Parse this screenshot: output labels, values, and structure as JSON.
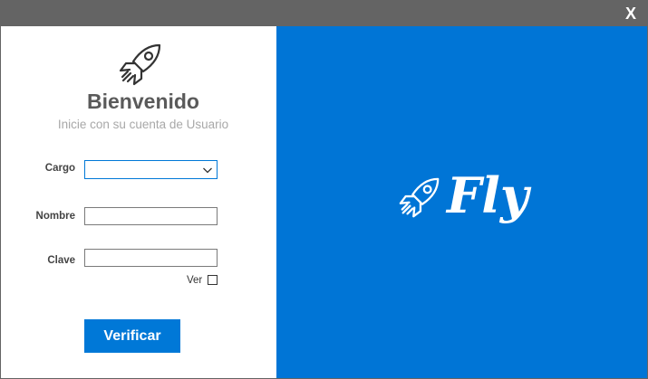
{
  "window": {
    "close_label": "X"
  },
  "login": {
    "title": "Bienvenido",
    "subtitle": "Inicie con su cuenta de Usuario",
    "fields": {
      "cargo_label": "Cargo",
      "cargo_value": "",
      "nombre_label": "Nombre",
      "nombre_value": "",
      "clave_label": "Clave",
      "clave_value": ""
    },
    "show_password_label": "Ver",
    "show_password_checked": false,
    "submit_label": "Verificar"
  },
  "brand": {
    "name": "Fly",
    "icon": "rocket-icon"
  },
  "colors": {
    "titlebar": "#646464",
    "accent": "#0078d7",
    "brand_panel": "#0075d6",
    "title_text": "#5a5a5a",
    "subtitle_text": "#a8a8a8"
  }
}
